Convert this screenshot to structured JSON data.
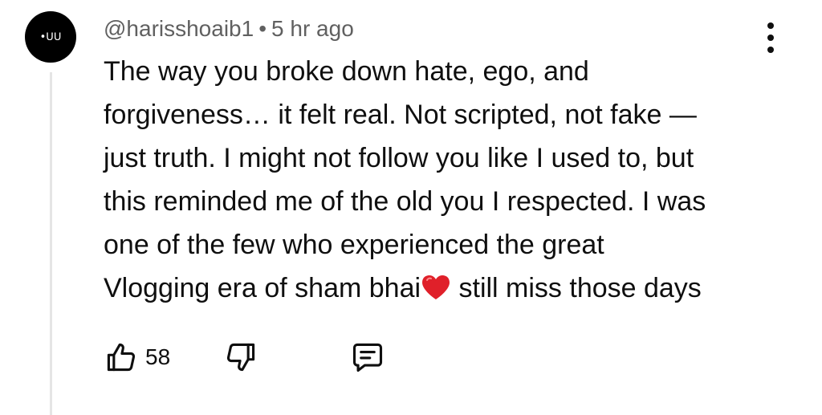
{
  "comment": {
    "avatar_text": "•ᑌᑌ",
    "username": "@harisshoaib1",
    "separator": "•",
    "timestamp": "5 hr ago",
    "body_lines": [
      "The way you broke down hate, ego, and",
      "forgiveness… it felt real. Not scripted, not fake —",
      "just truth. I might not follow you like I used to, but",
      "this reminded me of the old you I respected. I was",
      "one of the few who experienced the great"
    ],
    "last_line_before_emoji": "Vlogging era of sham bhai",
    "last_line_after_emoji": " still miss those days",
    "emoji": "red-heart",
    "like_count": "58"
  },
  "icons": {
    "more": "more-vertical-icon",
    "like": "thumbs-up-icon",
    "dislike": "thumbs-down-icon",
    "reply": "comment-reply-icon"
  },
  "colors": {
    "text": "#0f0f0f",
    "meta": "#606060",
    "thread": "#e5e5e5",
    "heart": "#e0202a"
  }
}
